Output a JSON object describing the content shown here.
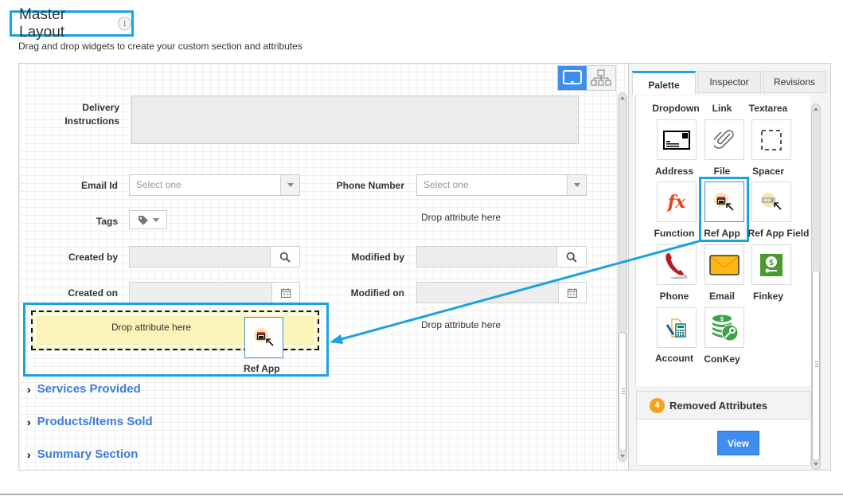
{
  "header": {
    "title": "Master Layout",
    "info_icon": "i",
    "subtitle": "Drag and drop widgets to create your custom section and attributes"
  },
  "view_toggle": {
    "desktop": "desktop-view-icon",
    "hierarchy": "hierarchy-view-icon",
    "active": "desktop"
  },
  "form": {
    "delivery_instructions_label_1": "Delivery",
    "delivery_instructions_label_2": "Instructions",
    "email_id_label": "Email Id",
    "email_id_placeholder": "Select one",
    "phone_number_label": "Phone Number",
    "phone_number_placeholder": "Select one",
    "tags_label": "Tags",
    "drop_attribute_right_1": "Drop attribute here",
    "created_by_label": "Created by",
    "modified_by_label": "Modified by",
    "created_on_label": "Created on",
    "modified_on_label": "Modified on",
    "drop_zone_text": "Drop attribute here",
    "drop_attribute_right_2": "Drop attribute here",
    "drag_ghost_label": "Ref App"
  },
  "sections": [
    {
      "label": "Services Provided"
    },
    {
      "label": "Products/Items Sold"
    },
    {
      "label": "Summary Section"
    }
  ],
  "panel": {
    "tabs": [
      {
        "label": "Palette",
        "active": true
      },
      {
        "label": "Inspector",
        "active": false
      },
      {
        "label": "Revisions",
        "active": false
      }
    ],
    "top_labels": [
      "Dropdown",
      "Link",
      "Textarea"
    ],
    "widgets": [
      {
        "label": "Address",
        "icon": "address-icon"
      },
      {
        "label": "File",
        "icon": "paperclip-icon"
      },
      {
        "label": "Spacer",
        "icon": "spacer-icon"
      },
      {
        "label": "Function",
        "icon": "function-icon"
      },
      {
        "label": "Ref App",
        "icon": "ref-app-icon",
        "selected": true
      },
      {
        "label": "Ref App Field",
        "icon": "ref-app-field-icon"
      },
      {
        "label": "Phone",
        "icon": "phone-icon"
      },
      {
        "label": "Email",
        "icon": "envelope-icon"
      },
      {
        "label": "Finkey",
        "icon": "finkey-icon"
      },
      {
        "label": "Account",
        "icon": "account-icon"
      },
      {
        "label": "ConKey",
        "icon": "conkey-icon"
      }
    ],
    "removed_attributes": {
      "count": "4",
      "title": "Removed Attributes",
      "view_label": "View"
    }
  },
  "colors": {
    "highlight": "#1ba3e1",
    "primary_button": "#3d8ef0",
    "section_link": "#3b7ddd",
    "badge": "#f7a11a",
    "drop_zone": "#fbf4b8"
  }
}
